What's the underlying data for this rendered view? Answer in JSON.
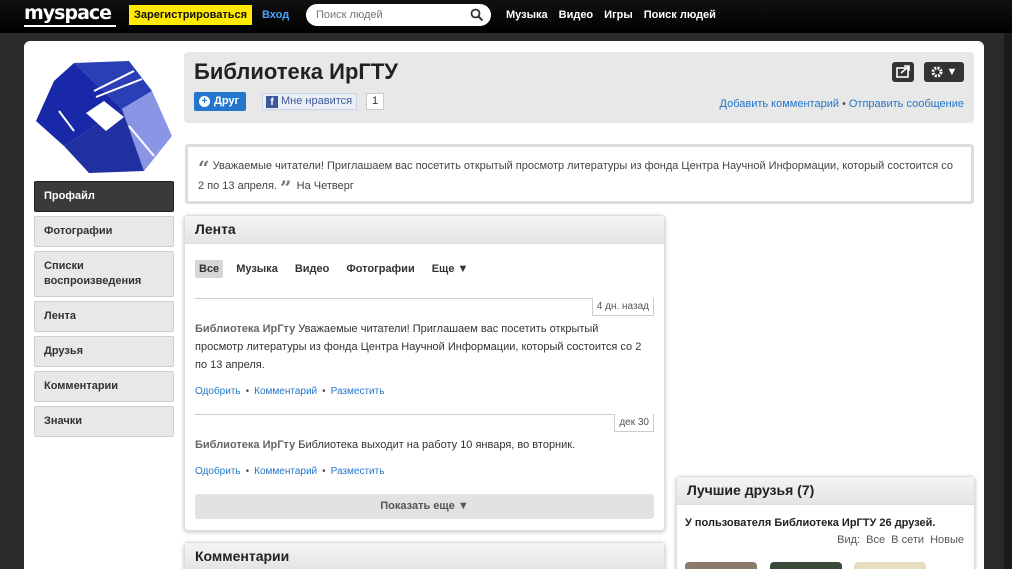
{
  "topbar": {
    "logo": "myspace",
    "register": "Зарегистрироваться",
    "login": "Вход",
    "search_placeholder": "Поиск людей",
    "nav": [
      "Музыка",
      "Видео",
      "Игры",
      "Поиск людей"
    ]
  },
  "sidebar": {
    "items": [
      {
        "label": "Профайл",
        "active": true
      },
      {
        "label": "Фотографии"
      },
      {
        "label": "Списки воспроизведения"
      },
      {
        "label": "Лента"
      },
      {
        "label": "Друзья"
      },
      {
        "label": "Комментарии"
      },
      {
        "label": "Значки"
      }
    ]
  },
  "header": {
    "title": "Библиотека ИрГТУ",
    "friend_button": "Друг",
    "like_button": "Мне нравится",
    "like_count": "1",
    "add_comment": "Добавить комментарий",
    "separator": "•",
    "send_message": "Отправить сообщение"
  },
  "status": {
    "text": "Уважаемые читатели! Приглашаем вас посетить открытый просмотр литературы из фонда Центра Научной Информации, который состоится со 2 по 13 апреля.",
    "when": "На Четверг"
  },
  "feed": {
    "title": "Лента",
    "filters": [
      "Все",
      "Музыка",
      "Видео",
      "Фотографии",
      "Еще ▼"
    ],
    "entries": [
      {
        "time": "4 дн. назад",
        "author": "Библиотека ИрГту",
        "text": "Уважаемые читатели! Приглашаем вас посетить открытый просмотр литературы из фонда Центра Научной Информации, который состоится со 2 по 13 апреля.",
        "actions": [
          "Одобрить",
          "Комментарий",
          "Разместить"
        ]
      },
      {
        "time": "дек 30",
        "author": "Библиотека ИрГту",
        "text": "Библиотека выходит на работу 10 января, во вторник.",
        "actions": [
          "Одобрить",
          "Комментарий",
          "Разместить"
        ]
      }
    ],
    "show_more": "Показать еще ▼"
  },
  "comments": {
    "title": "Комментарии"
  },
  "friends": {
    "title": "Лучшие друзья (7)",
    "subtitle": "У пользователя Библиотека ИрГТУ 26 друзей.",
    "view_label": "Вид:",
    "view_options": [
      "Все",
      "В сети",
      "Новые"
    ]
  }
}
